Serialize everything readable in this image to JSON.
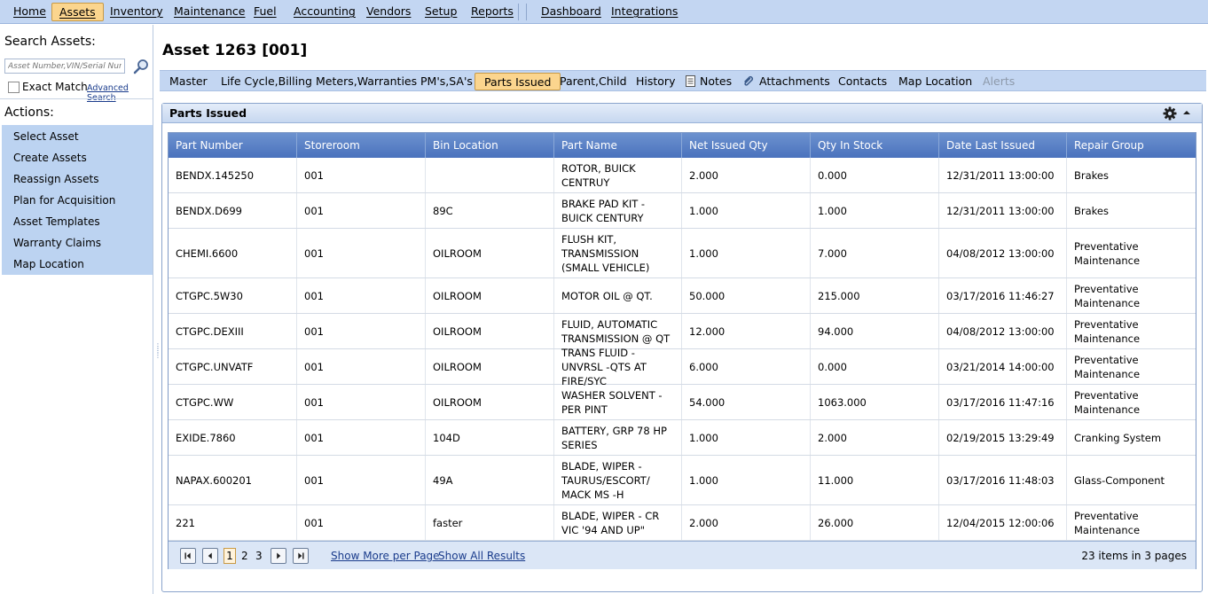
{
  "menu": {
    "items": [
      "Home",
      "Assets",
      "Inventory",
      "Maintenance",
      "Fuel",
      "Accounting",
      "Vendors",
      "Setup",
      "Reports"
    ],
    "items2": [
      "Dashboard",
      "Integrations"
    ]
  },
  "left": {
    "search_title": "Search Assets:",
    "search_placeholder": "Asset Number,VIN/Serial Number",
    "exact_match": "Exact Match",
    "advanced_search": "Advanced Search",
    "actions_title": "Actions:",
    "actions": [
      "Select Asset",
      "Create Assets",
      "Reassign Assets",
      "Plan for Acquisition",
      "Asset Templates",
      "Warranty Claims",
      "Map Location"
    ]
  },
  "asset_title": "Asset 1263 [001]",
  "tabs": [
    "Master",
    "Life Cycle,Billing",
    "Meters,Warranties",
    "PM's,SA's",
    "Parts Issued",
    "Parent,Child",
    "History",
    "Notes",
    "Attachments",
    "Contacts",
    "Map Location",
    "Alerts"
  ],
  "panel": {
    "title": "Parts Issued"
  },
  "grid": {
    "columns": [
      "Part Number",
      "Storeroom",
      "Bin Location",
      "Part Name",
      "Net Issued Qty",
      "Qty In Stock",
      "Date Last Issued",
      "Repair Group"
    ],
    "rows": [
      [
        "BENDX.145250",
        "001",
        "",
        "ROTOR, BUICK CENTRUY",
        "2.000",
        "0.000",
        "12/31/2011 13:00:00",
        "Brakes"
      ],
      [
        "BENDX.D699",
        "001",
        "89C",
        "BRAKE PAD KIT - BUICK CENTURY",
        "1.000",
        "1.000",
        "12/31/2011 13:00:00",
        "Brakes"
      ],
      [
        "CHEMI.6600",
        "001",
        "OILROOM",
        "FLUSH KIT, TRANSMISSION (SMALL VEHICLE)",
        "1.000",
        "7.000",
        "04/08/2012 13:00:00",
        "Preventative Maintenance"
      ],
      [
        "CTGPC.5W30",
        "001",
        "OILROOM",
        "MOTOR OIL @ QT.",
        "50.000",
        "215.000",
        "03/17/2016 11:46:27",
        "Preventative Maintenance"
      ],
      [
        "CTGPC.DEXIII",
        "001",
        "OILROOM",
        "FLUID, AUTOMATIC TRANSMISSION @ QT",
        "12.000",
        "94.000",
        "04/08/2012 13:00:00",
        "Preventative Maintenance"
      ],
      [
        "CTGPC.UNVATF",
        "001",
        "OILROOM",
        "TRANS FLUID - UNVRSL -QTS AT FIRE/SYC",
        "6.000",
        "0.000",
        "03/21/2014 14:00:00",
        "Preventative Maintenance"
      ],
      [
        "CTGPC.WW",
        "001",
        "OILROOM",
        "WASHER SOLVENT - PER PINT",
        "54.000",
        "1063.000",
        "03/17/2016 11:47:16",
        "Preventative Maintenance"
      ],
      [
        "EXIDE.7860",
        "001",
        "104D",
        "BATTERY, GRP 78 HP SERIES",
        "1.000",
        "2.000",
        "02/19/2015 13:29:49",
        "Cranking System"
      ],
      [
        "NAPAX.600201",
        "001",
        "49A",
        "BLADE, WIPER - TAURUS/ESCORT/ MACK MS -H",
        "1.000",
        "11.000",
        "03/17/2016 11:48:03",
        "Glass-Component"
      ],
      [
        "221",
        "001",
        "faster",
        "BLADE, WIPER - CR VIC '94 AND UP\"",
        "2.000",
        "26.000",
        "12/04/2015 12:00:06",
        "Preventative Maintenance"
      ]
    ]
  },
  "pager": {
    "pages": [
      "1",
      "2",
      "3"
    ],
    "show_more": "Show More per Page",
    "show_all": "Show All Results",
    "info": "23 items in 3 pages"
  },
  "colors": {
    "accent": "#fbd58e",
    "bar": "#c3d6f2",
    "header": "#4a72bd"
  },
  "icons": [
    "search-icon",
    "notes-icon",
    "paperclip-icon",
    "gear-icon",
    "collapse-up-icon",
    "first-page-icon",
    "prev-page-icon",
    "next-page-icon",
    "last-page-icon"
  ]
}
